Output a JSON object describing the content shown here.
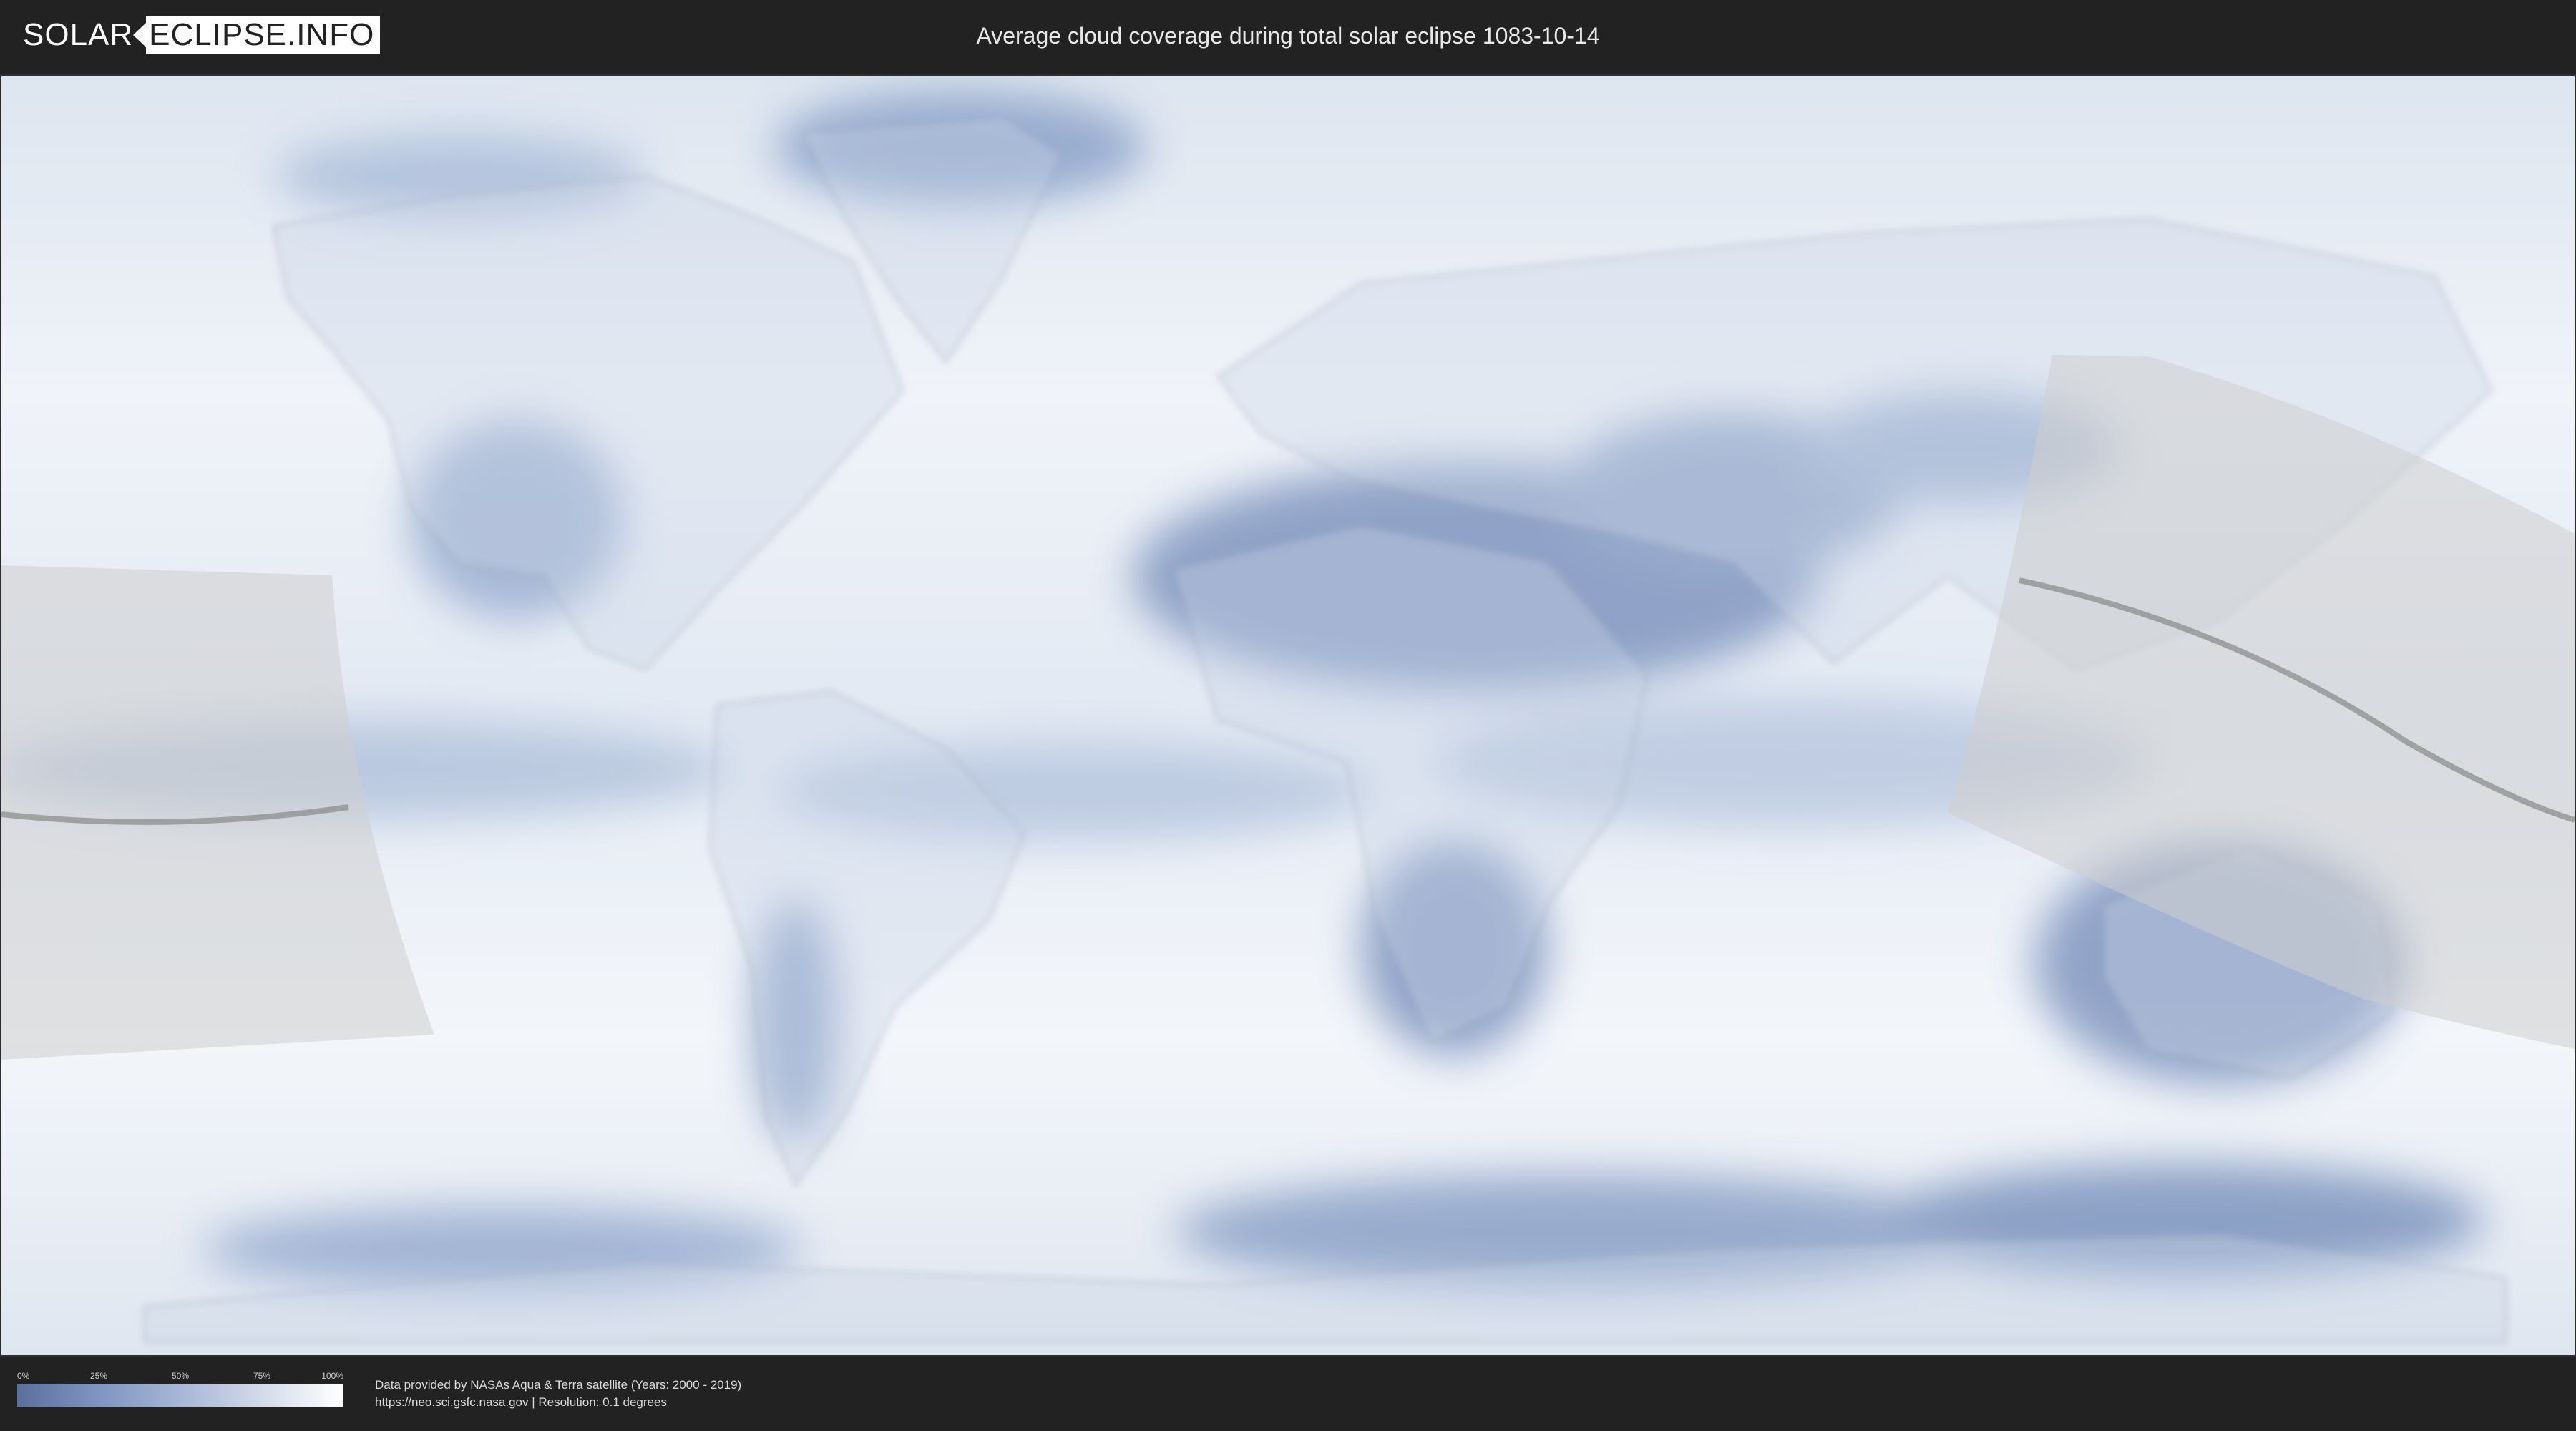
{
  "header": {
    "logo_solar": "SOLAR",
    "logo_eclipse": "ECLIPSE.INFO",
    "title": "Average cloud coverage during total solar eclipse 1083-10-14"
  },
  "map": {
    "projection": "equirectangular",
    "layer": "average cloud coverage",
    "eclipse_date": "1083-10-14",
    "colors": {
      "clear": "#4f6c9e",
      "cloudy": "#ffffff",
      "eclipse_band": "#c9c9c9",
      "central_line": "#7d7d7d",
      "borders": "#8d99ad"
    }
  },
  "legend": {
    "ticks": [
      "0%",
      "25%",
      "50%",
      "75%",
      "100%"
    ],
    "gradient_colors": [
      "#5a6f9c",
      "#7f95bf",
      "#a7b6d5",
      "#d3dbea",
      "#ffffff"
    ]
  },
  "credits": {
    "line1": "Data provided by NASAs Aqua & Terra satellite (Years: 2000 - 2019)",
    "line2": "https://neo.sci.gsfc.nasa.gov | Resolution: 0.1 degrees"
  }
}
